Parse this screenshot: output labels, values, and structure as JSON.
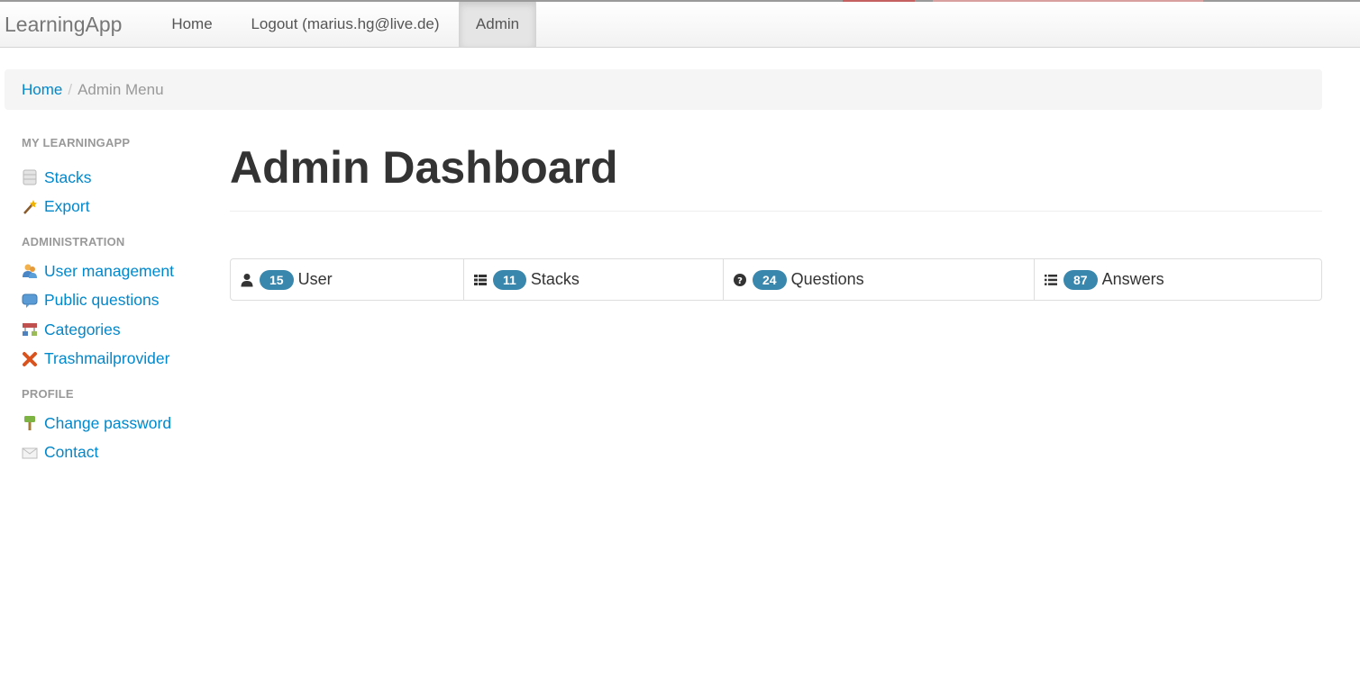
{
  "navbar": {
    "brand": "LearningApp",
    "links": [
      {
        "label": "Home"
      },
      {
        "label": "Logout (marius.hg@live.de)"
      },
      {
        "label": "Admin"
      }
    ]
  },
  "breadcrumb": {
    "home": "Home",
    "separator": "/",
    "current": "Admin Menu"
  },
  "sidebar": {
    "sections": [
      {
        "header": "MY LEARNINGAPP",
        "items": [
          {
            "label": "Stacks",
            "icon": "database-icon"
          },
          {
            "label": "Export",
            "icon": "magic-wand-icon"
          }
        ]
      },
      {
        "header": "ADMINISTRATION",
        "items": [
          {
            "label": "User management",
            "icon": "users-icon"
          },
          {
            "label": "Public questions",
            "icon": "comment-icon"
          },
          {
            "label": "Categories",
            "icon": "sitemap-icon"
          },
          {
            "label": "Trashmailprovider",
            "icon": "cross-icon"
          }
        ]
      },
      {
        "header": "PROFILE",
        "items": [
          {
            "label": "Change password",
            "icon": "key-icon"
          },
          {
            "label": "Contact",
            "icon": "envelope-icon"
          }
        ]
      }
    ]
  },
  "main": {
    "title": "Admin Dashboard",
    "stats": [
      {
        "count": "15",
        "label": "User",
        "icon": "user-icon"
      },
      {
        "count": "11",
        "label": "Stacks",
        "icon": "th-list-icon"
      },
      {
        "count": "24",
        "label": "Questions",
        "icon": "question-sign-icon"
      },
      {
        "count": "87",
        "label": "Answers",
        "icon": "list-icon"
      }
    ]
  },
  "colors": {
    "link": "#0088cc",
    "badge": "#3a87ad",
    "header_gray": "#999999"
  }
}
